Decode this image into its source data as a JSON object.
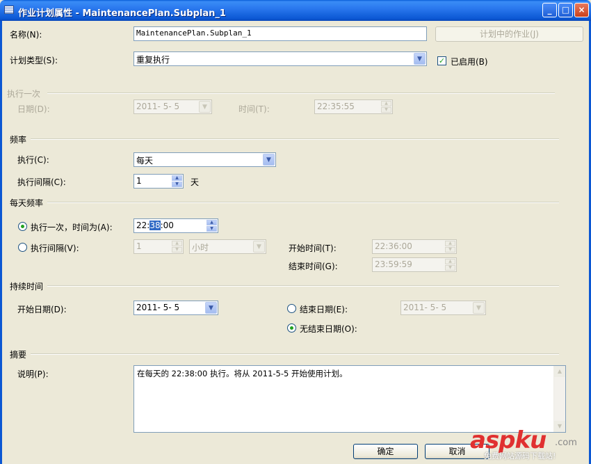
{
  "window": {
    "title": "作业计划属性 - MaintenancePlan.Subplan_1",
    "controls": {
      "minimize": "_",
      "maximize": "□",
      "close": "×"
    }
  },
  "general": {
    "name_label": "名称(N):",
    "name_value": "MaintenancePlan.Subplan_1",
    "jobs_button": "计划中的作业(J)",
    "schedule_type_label": "计划类型(S):",
    "schedule_type_value": "重复执行",
    "enabled_label": "已启用(B)",
    "enabled": true
  },
  "one_time": {
    "section": "执行一次",
    "date_label": "日期(D):",
    "date_value": "2011- 5- 5",
    "time_label": "时间(T):",
    "time_value": "22:35:55"
  },
  "frequency": {
    "section": "频率",
    "occurs_label": "执行(C):",
    "occurs_value": "每天",
    "recurs_label": "执行间隔(C):",
    "recurs_value": "1",
    "recurs_unit": "天"
  },
  "daily_frequency": {
    "section": "每天频率",
    "once_label": "执行一次，时间为(A):",
    "once_time_prefix": "22:",
    "once_time_selected": "38",
    "once_time_suffix": ":00",
    "once_selected": true,
    "every_label": "执行间隔(V):",
    "every_value": "1",
    "every_unit": "小时",
    "start_time_label": "开始时间(T):",
    "start_time_value": "22:36:00",
    "end_time_label": "结束时间(G):",
    "end_time_value": "23:59:59"
  },
  "duration": {
    "section": "持续时间",
    "start_date_label": "开始日期(D):",
    "start_date_value": "2011- 5- 5",
    "end_date_label": "结束日期(E):",
    "end_date_value": "2011- 5- 5",
    "no_end_label": "无结束日期(O):",
    "no_end_selected": true
  },
  "summary": {
    "section": "摘要",
    "desc_label": "说明(P):",
    "desc_text": "在每天的 22:38:00 执行。将从 2011-5-5 开始使用计划。"
  },
  "buttons": {
    "ok": "确定",
    "cancel": "取消"
  },
  "watermark": {
    "brand": "aspku",
    "domain": ".com",
    "tagline": "免费网站源码下载站!"
  }
}
